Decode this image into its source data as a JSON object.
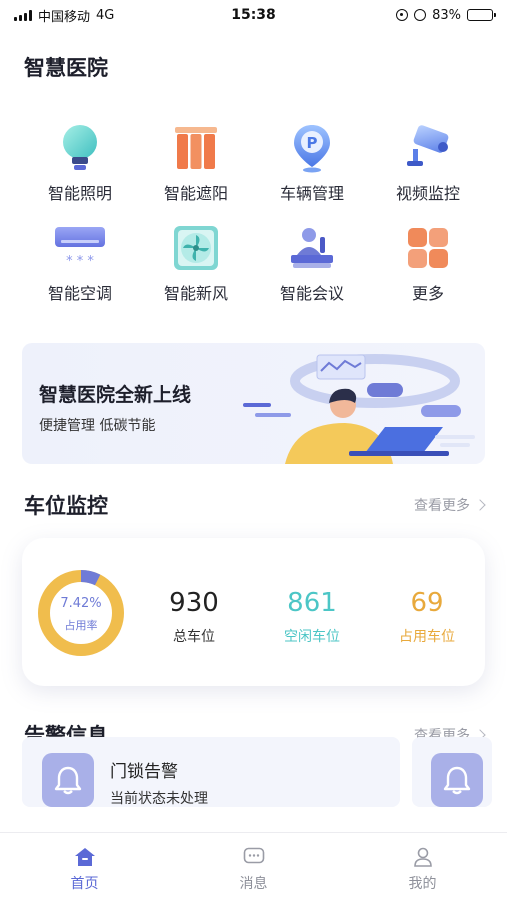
{
  "status_bar": {
    "carrier": "中国移动",
    "network": "4G",
    "time": "15:38",
    "battery": "83%",
    "battery_level": 0.83
  },
  "page": {
    "title": "智慧医院"
  },
  "grid": {
    "items": [
      {
        "label": "智能照明",
        "icon": "bulb-icon"
      },
      {
        "label": "智能遮阳",
        "icon": "blinds-icon"
      },
      {
        "label": "车辆管理",
        "icon": "parking-pin-icon"
      },
      {
        "label": "视频监控",
        "icon": "camera-icon"
      },
      {
        "label": "智能空调",
        "icon": "air-conditioner-icon"
      },
      {
        "label": "智能新风",
        "icon": "fan-icon"
      },
      {
        "label": "智能会议",
        "icon": "meeting-icon"
      },
      {
        "label": "更多",
        "icon": "more-grid-icon"
      }
    ]
  },
  "banner": {
    "title": "智慧医院全新上线",
    "subtitle": "便捷管理 低碳节能"
  },
  "parking": {
    "section_title": "车位监控",
    "more_label": "查看更多",
    "occupancy_rate": "7.42%",
    "occupancy_fraction": 0.0742,
    "occupancy_caption": "占用率",
    "total": {
      "value": "930",
      "label": "总车位"
    },
    "free": {
      "value": "861",
      "label": "空闲车位"
    },
    "used": {
      "value": "69",
      "label": "占用车位"
    },
    "colors": {
      "free": "#f0bd4d",
      "used": "#6f7bd6",
      "free_text": "#4cc6c6",
      "used_text": "#e8a93c"
    }
  },
  "alerts": {
    "section_title": "告警信息",
    "more_label": "查看更多",
    "items": [
      {
        "title": "门锁告警",
        "status": "当前状态未处理"
      }
    ]
  },
  "tabbar": {
    "tabs": [
      {
        "label": "首页",
        "icon": "home-icon",
        "active": true
      },
      {
        "label": "消息",
        "icon": "message-icon",
        "active": false
      },
      {
        "label": "我的",
        "icon": "user-icon",
        "active": false
      }
    ]
  },
  "theme": {
    "accent": "#5b69d6",
    "text": "#1d1f2b"
  }
}
